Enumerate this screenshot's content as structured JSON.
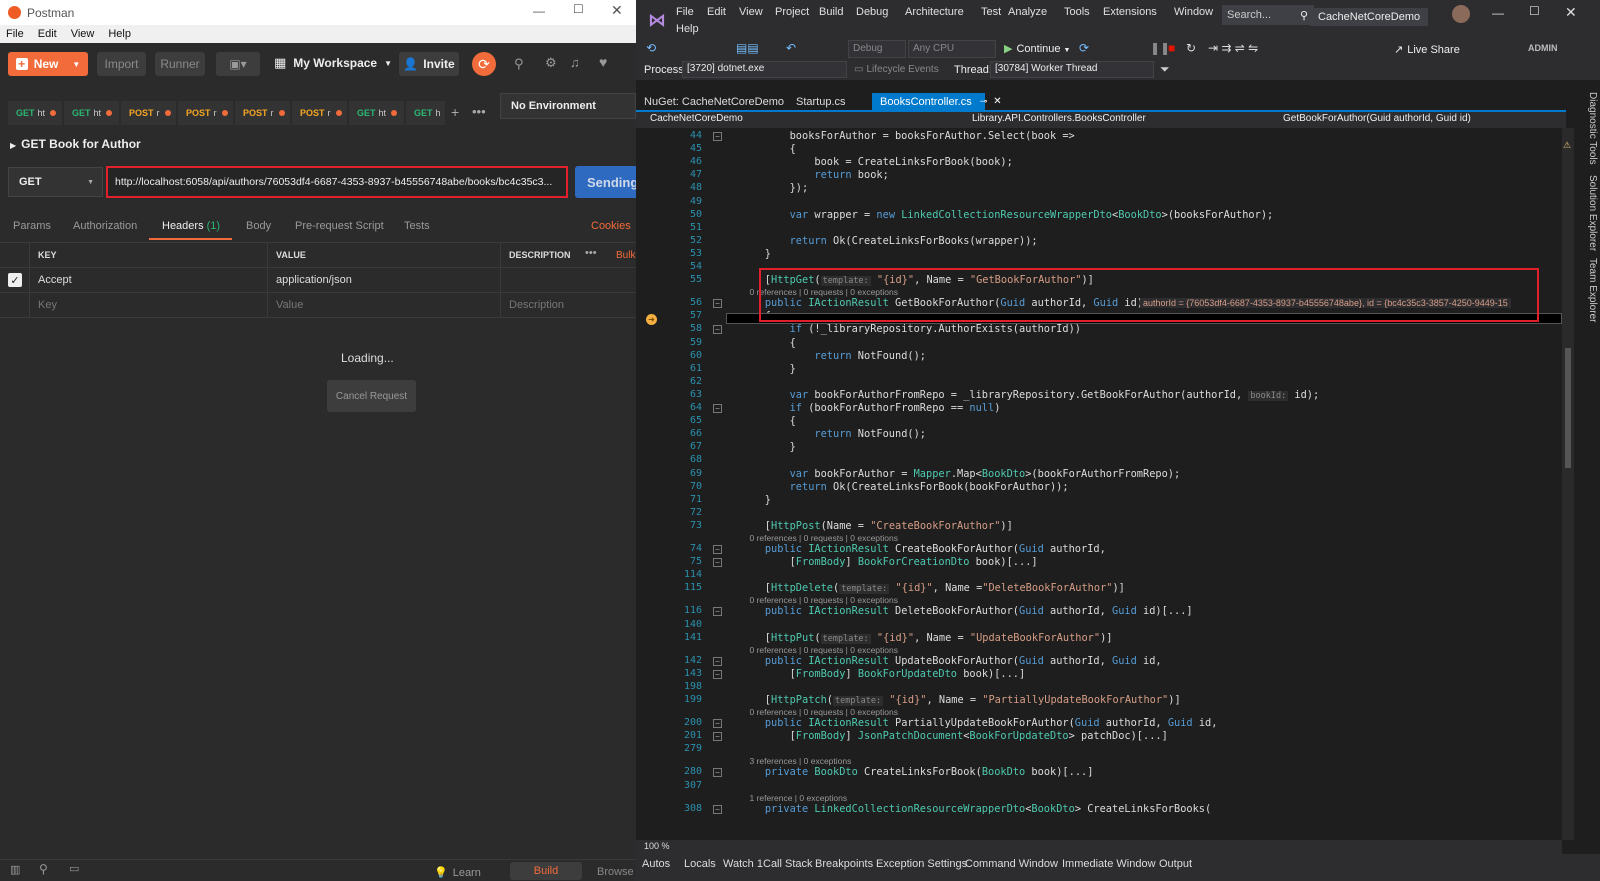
{
  "postman": {
    "title": "Postman",
    "menu": [
      "File",
      "Edit",
      "View",
      "Help"
    ],
    "toolbar": {
      "new": "New",
      "import": "Import",
      "runner": "Runner",
      "workspace": "My Workspace",
      "invite": "Invite"
    },
    "tabs": [
      {
        "method": "GET",
        "label": "ht"
      },
      {
        "method": "GET",
        "label": "ht"
      },
      {
        "method": "POST",
        "label": "r"
      },
      {
        "method": "POST",
        "label": "r"
      },
      {
        "method": "POST",
        "label": "r"
      },
      {
        "method": "POST",
        "label": "r"
      },
      {
        "method": "GET",
        "label": "ht"
      },
      {
        "method": "GET",
        "label": "h"
      }
    ],
    "environment": "No Environment",
    "request_name": "GET Book for Author",
    "method": "GET",
    "url": "http://localhost:6058/api/authors/76053df4-6687-4353-8937-b45556748abe/books/bc4c35c3...",
    "send_label": "Sending",
    "request_tabs": [
      "Params",
      "Authorization",
      "Headers",
      "Body",
      "Pre-request Script",
      "Tests"
    ],
    "headers_count": "(1)",
    "cookies": "Cookies",
    "columns": {
      "key": "KEY",
      "value": "VALUE",
      "description": "DESCRIPTION",
      "bulk": "Bulk"
    },
    "header_row": {
      "key": "Accept",
      "value": "application/json"
    },
    "placeholders": {
      "key": "Key",
      "value": "Value",
      "description": "Description"
    },
    "loading": "Loading...",
    "cancel": "Cancel Request",
    "footer": {
      "learn": "Learn",
      "build": "Build",
      "browse": "Browse"
    }
  },
  "vs": {
    "menu": [
      "File",
      "Edit",
      "View",
      "Project",
      "Build",
      "Debug",
      "Architecture",
      "Test",
      "Analyze",
      "Tools",
      "Extensions",
      "Window"
    ],
    "menu_help": "Help",
    "search": "Search...",
    "solution": "CacheNetCoreDemo",
    "config": "Debug",
    "platform": "Any CPU",
    "continue": "Continue",
    "live_share": "Live Share",
    "admin": "ADMIN",
    "process_label": "Process:",
    "process": "[3720] dotnet.exe",
    "lifecycle": "Lifecycle Events",
    "thread_label": "Thread:",
    "thread": "[30784] Worker Thread",
    "doc_tabs": [
      "NuGet: CacheNetCoreDemo",
      "Startup.cs",
      "BooksController.cs"
    ],
    "nav": {
      "project": "CacheNetCoreDemo",
      "class": "Library.API.Controllers.BooksController",
      "member": "GetBookForAuthor(Guid authorId, Guid id)"
    },
    "zoom": "100 %",
    "bottom_tabs": [
      "Autos",
      "Locals",
      "Watch 1",
      "Call Stack",
      "Breakpoints",
      "Exception Settings",
      "Command Window",
      "Immediate Window",
      "Output"
    ],
    "side_tabs": [
      "Diagnostic Tools",
      "Solution Explorer",
      "Team Explorer"
    ],
    "lines": [
      {
        "n": "44",
        "t": "        booksForAuthor = booksForAuthor.Select(book =>"
      },
      {
        "n": "45",
        "t": "        {"
      },
      {
        "n": "46",
        "t": "            book = CreateLinksForBook(book);"
      },
      {
        "n": "47",
        "t": "            return book;"
      },
      {
        "n": "48",
        "t": "        });"
      },
      {
        "n": "49",
        "t": ""
      },
      {
        "n": "50",
        "t": "        var wrapper = new LinkedCollectionResourceWrapperDto<BookDto>(booksForAuthor);"
      },
      {
        "n": "51",
        "t": ""
      },
      {
        "n": "52",
        "t": "        return Ok(CreateLinksForBooks(wrapper));"
      },
      {
        "n": "53",
        "t": "    }"
      },
      {
        "n": "54",
        "t": ""
      },
      {
        "n": "55",
        "t": "    [HttpGet(template: \"{id}\", Name = \"GetBookForAuthor\")]"
      },
      {
        "n": "",
        "lens": "    0 references | 0 requests | 0 exceptions"
      },
      {
        "n": "56",
        "t": "    public IActionResult GetBookForAuthor(Guid authorId, Guid id)"
      },
      {
        "n": "57",
        "t": "    {"
      },
      {
        "n": "58",
        "t": "        if (!_libraryRepository.AuthorExists(authorId))"
      },
      {
        "n": "59",
        "t": "        {"
      },
      {
        "n": "60",
        "t": "            return NotFound();"
      },
      {
        "n": "61",
        "t": "        }"
      },
      {
        "n": "62",
        "t": ""
      },
      {
        "n": "63",
        "t": "        var bookForAuthorFromRepo = _libraryRepository.GetBookForAuthor(authorId, bookId: id);"
      },
      {
        "n": "64",
        "t": "        if (bookForAuthorFromRepo == null)"
      },
      {
        "n": "65",
        "t": "        {"
      },
      {
        "n": "66",
        "t": "            return NotFound();"
      },
      {
        "n": "67",
        "t": "        }"
      },
      {
        "n": "68",
        "t": ""
      },
      {
        "n": "69",
        "t": "        var bookForAuthor = Mapper.Map<BookDto>(bookForAuthorFromRepo);"
      },
      {
        "n": "70",
        "t": "        return Ok(CreateLinksForBook(bookForAuthor));"
      },
      {
        "n": "71",
        "t": "    }"
      },
      {
        "n": "72",
        "t": ""
      },
      {
        "n": "73",
        "t": "    [HttpPost(Name = \"CreateBookForAuthor\")]"
      },
      {
        "n": "",
        "lens": "    0 references | 0 requests | 0 exceptions"
      },
      {
        "n": "74",
        "t": "    public IActionResult CreateBookForAuthor(Guid authorId,"
      },
      {
        "n": "75",
        "t": "        [FromBody] BookForCreationDto book)[...]"
      },
      {
        "n": "114",
        "t": ""
      },
      {
        "n": "115",
        "t": "    [HttpDelete(template: \"{id}\", Name =\"DeleteBookForAuthor\")]"
      },
      {
        "n": "",
        "lens": "    0 references | 0 requests | 0 exceptions"
      },
      {
        "n": "116",
        "t": "    public IActionResult DeleteBookForAuthor(Guid authorId, Guid id)[...]"
      },
      {
        "n": "140",
        "t": ""
      },
      {
        "n": "141",
        "t": "    [HttpPut(template: \"{id}\", Name = \"UpdateBookForAuthor\")]"
      },
      {
        "n": "",
        "lens": "    0 references | 0 requests | 0 exceptions"
      },
      {
        "n": "142",
        "t": "    public IActionResult UpdateBookForAuthor(Guid authorId, Guid id,"
      },
      {
        "n": "143",
        "t": "        [FromBody] BookForUpdateDto book)[...]"
      },
      {
        "n": "198",
        "t": ""
      },
      {
        "n": "199",
        "t": "    [HttpPatch(template: \"{id}\", Name = \"PartiallyUpdateBookForAuthor\")]"
      },
      {
        "n": "",
        "lens": "    0 references | 0 requests | 0 exceptions"
      },
      {
        "n": "200",
        "t": "    public IActionResult PartiallyUpdateBookForAuthor(Guid authorId, Guid id,"
      },
      {
        "n": "201",
        "t": "        [FromBody] JsonPatchDocument<BookForUpdateDto> patchDoc)[...]"
      },
      {
        "n": "279",
        "t": ""
      },
      {
        "n": "",
        "lens": "    3 references | 0 exceptions"
      },
      {
        "n": "280",
        "t": "    private BookDto CreateLinksForBook(BookDto book)[...]"
      },
      {
        "n": "307",
        "t": ""
      },
      {
        "n": "",
        "lens": "    1 reference | 0 exceptions"
      },
      {
        "n": "308",
        "t": "    private LinkedCollectionResourceWrapperDto<BookDto> CreateLinksForBooks("
      }
    ],
    "datatip": "authorId = {76053df4-6687-4353-8937-b45556748abe},  id = {bc4c35c3-3857-4250-9449-15"
  }
}
